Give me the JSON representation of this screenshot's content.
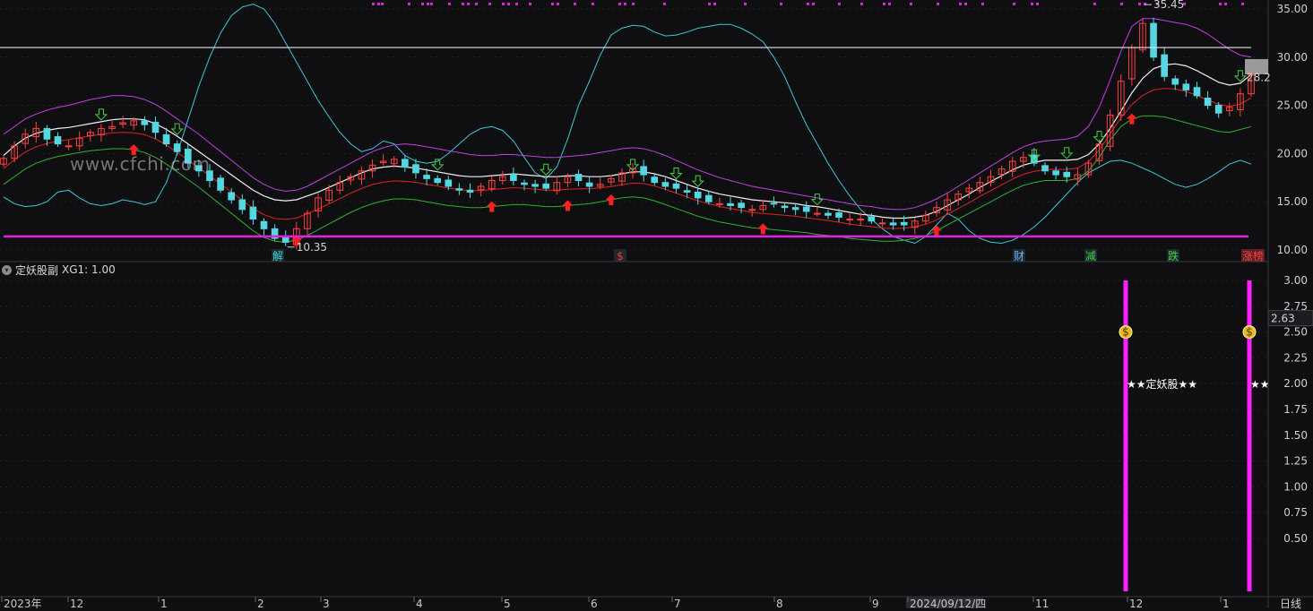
{
  "watermark": "www.cfchi.com",
  "indicator": {
    "name": "定妖股副",
    "value_label": "XG1: 1.00"
  },
  "period_label": "日线",
  "colors": {
    "background": "#0f0f12",
    "candle_up": "#ff4040",
    "candle_down": "#54d7e0",
    "ma_mid": "#f0f0f0",
    "band_upper": "#c040e0",
    "band_inner": "#e02020",
    "band_lower": "#30b030",
    "cyan_line": "#3cc8d8",
    "support_line": "#e020e0",
    "resistance_line": "#e8e8e8",
    "signal_bar": "#ff20ff"
  },
  "chart_data": [
    {
      "type": "candlestick",
      "panel": "main",
      "y_ticks": [
        "35.00",
        "30.00",
        "25.00",
        "20.00",
        "15.00",
        "10.00"
      ],
      "ylim": [
        9.5,
        36.0
      ],
      "price_high_label": "35.45",
      "price_low_label": "10.35",
      "current_price_label": "28.2",
      "resistance_level": 31.0,
      "support_level": 11.4,
      "x_labels": [
        "2023年",
        "12",
        "1",
        "2",
        "3",
        "4",
        "5",
        "6",
        "7",
        "8",
        "9",
        "2024/09/12/四",
        "11",
        "12",
        "1"
      ],
      "event_markers": [
        {
          "label": "解",
          "color": "#40d0e0"
        },
        {
          "label": "$",
          "color": "#ff3030"
        },
        {
          "label": "财",
          "color": "#6fb0ff"
        },
        {
          "label": "减",
          "color": "#40d040"
        },
        {
          "label": "跌",
          "color": "#40d040"
        },
        {
          "label": "涨榜",
          "color": "#ff4040"
        }
      ],
      "close_series": [
        19.5,
        20.8,
        22.0,
        22.6,
        21.5,
        21.0,
        20.8,
        21.6,
        22.2,
        22.6,
        22.8,
        23.2,
        23.4,
        23.0,
        22.2,
        21.0,
        20.2,
        19.0,
        18.2,
        17.2,
        16.2,
        15.2,
        14.2,
        13.2,
        12.2,
        11.2,
        10.8,
        12.2,
        13.8,
        15.4,
        16.2,
        17.0,
        17.6,
        18.2,
        18.8,
        19.2,
        19.4,
        18.6,
        18.0,
        17.4,
        17.0,
        16.6,
        16.2,
        16.0,
        16.6,
        17.2,
        17.6,
        17.2,
        16.8,
        16.6,
        16.4,
        17.0,
        17.6,
        17.2,
        16.6,
        16.8,
        17.4,
        18.0,
        18.4,
        17.8,
        17.0,
        16.6,
        16.4,
        16.0,
        15.4,
        15.0,
        14.8,
        14.6,
        14.4,
        14.2,
        14.6,
        14.8,
        14.4,
        14.2,
        14.0,
        13.8,
        13.6,
        13.4,
        13.2,
        13.2,
        13.0,
        12.8,
        12.6,
        12.6,
        13.0,
        13.6,
        14.4,
        15.2,
        15.8,
        16.4,
        17.0,
        17.6,
        18.4,
        19.2,
        19.6,
        19.0,
        18.2,
        17.8,
        17.6,
        17.8,
        19.0,
        21.0,
        24.0,
        27.5,
        31.0,
        33.5,
        30.0,
        28.0,
        27.2,
        26.6,
        26.0,
        25.0,
        24.2,
        24.8,
        26.2,
        28.2
      ],
      "ma_mid": [
        19.8,
        20.8,
        21.6,
        22.1,
        22.4,
        22.6,
        22.7,
        22.9,
        23.1,
        23.3,
        23.5,
        23.6,
        23.6,
        23.5,
        23.1,
        22.5,
        21.8,
        21.0,
        20.2,
        19.4,
        18.6,
        17.8,
        17.0,
        16.2,
        15.6,
        15.2,
        15.1,
        15.2,
        15.6,
        16.0,
        16.5,
        17.0,
        17.5,
        18.0,
        18.4,
        18.6,
        18.7,
        18.6,
        18.5,
        18.3,
        18.1,
        17.9,
        17.7,
        17.6,
        17.6,
        17.7,
        17.8,
        17.9,
        17.8,
        17.7,
        17.6,
        17.6,
        17.7,
        17.7,
        17.6,
        17.6,
        17.7,
        17.9,
        18.1,
        18.1,
        17.9,
        17.6,
        17.2,
        16.8,
        16.4,
        16.1,
        15.8,
        15.6,
        15.4,
        15.2,
        15.1,
        15.0,
        14.9,
        14.8,
        14.6,
        14.5,
        14.3,
        14.1,
        13.9,
        13.7,
        13.6,
        13.4,
        13.3,
        13.3,
        13.4,
        13.6,
        14.0,
        14.6,
        15.2,
        15.8,
        16.5,
        17.1,
        17.7,
        18.3,
        18.8,
        19.1,
        19.3,
        19.3,
        19.3,
        19.4,
        19.9,
        21.0,
        22.6,
        24.4,
        26.3,
        27.8,
        28.8,
        29.2,
        29.3,
        29.1,
        28.6,
        28.0,
        27.4,
        27.1,
        27.3,
        28.2
      ],
      "band_upper": [
        22.0,
        22.8,
        23.6,
        24.1,
        24.5,
        24.8,
        25.0,
        25.3,
        25.6,
        25.8,
        26.0,
        26.0,
        25.9,
        25.6,
        25.1,
        24.4,
        23.6,
        22.8,
        22.0,
        21.1,
        20.2,
        19.3,
        18.4,
        17.5,
        16.8,
        16.3,
        16.1,
        16.2,
        16.6,
        17.2,
        17.8,
        18.4,
        19.0,
        19.6,
        20.2,
        20.6,
        20.9,
        21.0,
        20.9,
        20.7,
        20.5,
        20.3,
        20.1,
        19.9,
        19.8,
        19.8,
        19.9,
        19.9,
        19.8,
        19.7,
        19.6,
        19.6,
        19.7,
        19.8,
        19.9,
        20.1,
        20.3,
        20.5,
        20.6,
        20.5,
        20.2,
        19.8,
        19.3,
        18.8,
        18.3,
        17.9,
        17.5,
        17.2,
        16.9,
        16.6,
        16.4,
        16.2,
        16.0,
        15.8,
        15.6,
        15.4,
        15.2,
        15.0,
        14.8,
        14.6,
        14.5,
        14.3,
        14.2,
        14.2,
        14.4,
        14.8,
        15.3,
        15.9,
        16.6,
        17.3,
        18.0,
        18.7,
        19.4,
        20.1,
        20.7,
        21.1,
        21.3,
        21.4,
        21.5,
        21.8,
        22.8,
        24.8,
        27.6,
        30.6,
        33.2,
        34.0,
        34.0,
        33.8,
        33.6,
        33.4,
        33.0,
        32.4,
        31.6,
        30.8,
        30.2,
        30.0
      ],
      "band_lower": [
        16.8,
        17.6,
        18.4,
        19.0,
        19.4,
        19.7,
        19.9,
        20.1,
        20.3,
        20.4,
        20.5,
        20.5,
        20.4,
        20.1,
        19.6,
        18.9,
        18.1,
        17.3,
        16.5,
        15.6,
        14.7,
        13.8,
        12.9,
        12.0,
        11.3,
        10.9,
        10.8,
        11.0,
        11.5,
        12.1,
        12.7,
        13.3,
        13.9,
        14.4,
        14.8,
        15.1,
        15.3,
        15.3,
        15.2,
        15.0,
        14.8,
        14.6,
        14.5,
        14.4,
        14.4,
        14.5,
        14.6,
        14.7,
        14.7,
        14.6,
        14.5,
        14.5,
        14.6,
        14.7,
        14.8,
        15.0,
        15.2,
        15.4,
        15.5,
        15.4,
        15.1,
        14.7,
        14.3,
        13.9,
        13.5,
        13.2,
        12.9,
        12.7,
        12.5,
        12.3,
        12.2,
        12.1,
        12.0,
        11.9,
        11.8,
        11.6,
        11.5,
        11.4,
        11.2,
        11.1,
        11.0,
        10.9,
        10.9,
        11.0,
        11.2,
        11.5,
        12.0,
        12.6,
        13.2,
        13.8,
        14.4,
        15.0,
        15.6,
        16.2,
        16.7,
        17.0,
        17.2,
        17.2,
        17.2,
        17.4,
        18.2,
        19.6,
        21.4,
        22.8,
        23.6,
        23.9,
        23.9,
        23.8,
        23.5,
        23.2,
        22.9,
        22.6,
        22.3,
        22.2,
        22.5,
        22.8
      ],
      "cyan_line": [
        15.5,
        14.8,
        14.5,
        14.6,
        15.0,
        16.0,
        16.2,
        15.4,
        14.8,
        14.6,
        14.8,
        15.2,
        15.0,
        14.7,
        15.0,
        17.0,
        20.0,
        23.5,
        27.0,
        30.0,
        32.5,
        34.3,
        35.2,
        35.5,
        35.0,
        33.5,
        31.5,
        29.5,
        27.5,
        25.5,
        23.8,
        22.2,
        21.0,
        20.2,
        20.5,
        21.3,
        21.0,
        19.8,
        19.2,
        19.0,
        19.2,
        20.0,
        21.0,
        22.0,
        22.6,
        22.8,
        22.4,
        21.3,
        19.6,
        18.0,
        17.4,
        18.6,
        21.5,
        25.0,
        27.5,
        30.2,
        32.3,
        33.0,
        33.3,
        33.2,
        32.6,
        32.2,
        32.3,
        32.6,
        33.0,
        33.2,
        33.4,
        33.4,
        33.0,
        32.4,
        31.6,
        30.0,
        28.0,
        25.4,
        23.0,
        21.0,
        19.0,
        17.2,
        15.6,
        14.2,
        13.2,
        12.2,
        11.4,
        11.0,
        10.7,
        11.4,
        12.6,
        13.8,
        13.2,
        12.0,
        11.2,
        10.8,
        10.7,
        11.0,
        11.6,
        12.4,
        13.4,
        14.6,
        15.8,
        17.0,
        18.0,
        18.6,
        19.2,
        19.3,
        19.0,
        18.5,
        18.0,
        17.4,
        16.8,
        16.5,
        16.8,
        17.4,
        18.1,
        18.9,
        19.3,
        18.9
      ]
    },
    {
      "type": "bar",
      "panel": "indicator",
      "name": "XG1",
      "y_ticks": [
        "3.00",
        "2.75",
        "2.50",
        "2.25",
        "2.00",
        "1.75",
        "1.50",
        "1.25",
        "1.00",
        "0.75",
        "0.50"
      ],
      "ylim": [
        0.0,
        3.1
      ],
      "current_value_label": "2.63",
      "signals": [
        {
          "bar_index": 105,
          "value": 3.0,
          "icon": "money-bag-icon",
          "icon_value": 2.5,
          "label": "★★定妖股★★",
          "label_value": 2.0
        },
        {
          "bar_index": 117,
          "value": 3.0,
          "icon": "money-bag-icon",
          "icon_value": 2.5,
          "label": "★★定妖股★★",
          "label_value": 2.0
        }
      ]
    }
  ]
}
